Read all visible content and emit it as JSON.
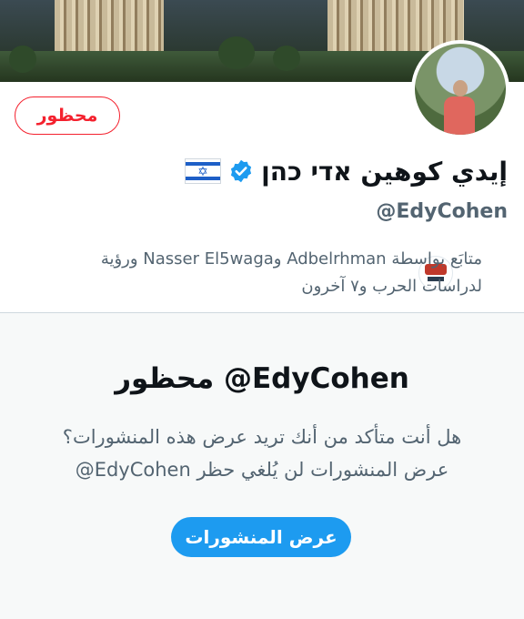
{
  "profile": {
    "display_name": "إيدي كوهين אדי כהן",
    "handle": "@EdyCohen",
    "blocked_label": "محظور",
    "verified": true,
    "flag": "israel-flag-icon"
  },
  "followers": {
    "line1": "متابَع بواسطة Adbelrhman وNasser El5waga ورؤية",
    "line2": "لدراسات الحرب و٧ آخرون"
  },
  "blocked_notice": {
    "title": "EdyCohen@ محظور",
    "question": "هل أنت متأكد من أنك تريد عرض هذه المنشورات؟",
    "note": "عرض المنشورات لن يُلغي حظر EdyCohen@",
    "button_label": "عرض المنشورات"
  },
  "colors": {
    "accent": "#1d9bf0",
    "blocked_red": "#f4212e",
    "secondary_text": "#536471"
  }
}
